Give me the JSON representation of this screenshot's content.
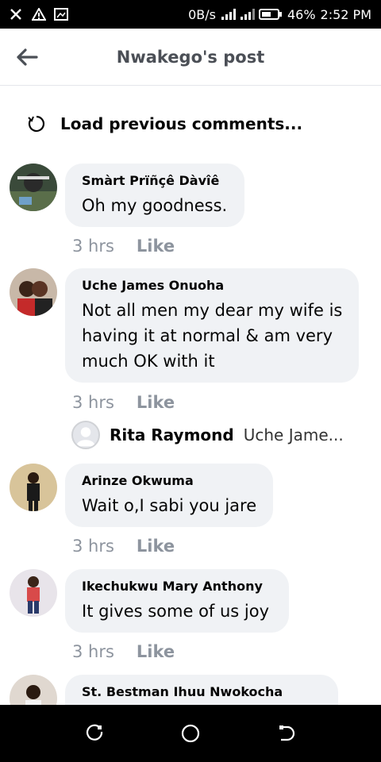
{
  "status": {
    "network_speed": "0B/s",
    "battery": "46%",
    "time": "2:52 PM"
  },
  "header": {
    "title": "Nwakego's post"
  },
  "load_previous": "Load previous comments...",
  "comments": [
    {
      "author": "Smàrt Prïñçê Dàvîê",
      "text": "Oh my goodness.",
      "time": "3 hrs",
      "like": "Like"
    },
    {
      "author": "Uche James Onuoha",
      "text_lines": [
        "Not all men my dear my wife is",
        "having it at normal & am very",
        "much OK with it"
      ],
      "time": "3 hrs",
      "like": "Like"
    },
    {
      "author": "Arinze Okwuma",
      "text": "Wait o,I sabi you jare",
      "time": "3 hrs",
      "like": "Like"
    },
    {
      "author": "Ikechukwu Mary Anthony",
      "text": "It gives some of us joy",
      "time": "3 hrs",
      "like": "Like"
    },
    {
      "author": "St. Bestman Ihuu Nwokocha"
    }
  ],
  "reply": {
    "author": "Rita Raymond",
    "preview": "Uche Jame..."
  }
}
